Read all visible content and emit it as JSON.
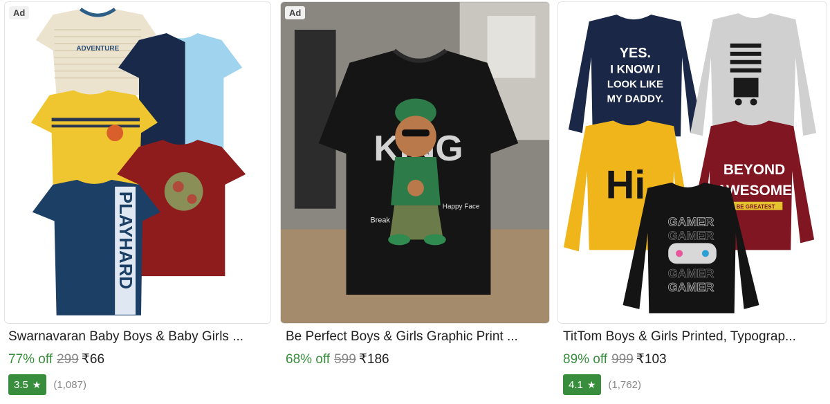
{
  "products": [
    {
      "ad": "Ad",
      "title": "Swarnavaran Baby Boys & Baby Girls ...",
      "discount": "77% off",
      "mrp": "299",
      "price": "₹66",
      "rating": "3.5",
      "rating_count": "(1,087)",
      "image_text": [
        "ADVENTURE",
        "PLAYHARD"
      ]
    },
    {
      "ad": "Ad",
      "title": "Be Perfect Boys & Girls Graphic Print ...",
      "discount": "68% off",
      "mrp": "599",
      "price": "₹186",
      "image_text": [
        "KING",
        "Break",
        "Happy Face"
      ]
    },
    {
      "title": "TitTom Boys & Girls Printed, Typograp...",
      "discount": "89% off",
      "mrp": "999",
      "price": "₹103",
      "rating": "4.1",
      "rating_count": "(1,762)",
      "image_text": [
        "YES.",
        "I KNOW I",
        "LOOK LIKE",
        "MY DADDY.",
        "Hi",
        "BEYOND",
        "AWESOME",
        "BE GREATEST",
        "GAMER"
      ]
    }
  ],
  "icons": {
    "rating": "star-icon"
  },
  "colors": {
    "discount": "#388e3c",
    "rating_badge": "#388e3c",
    "muted": "#878787"
  }
}
